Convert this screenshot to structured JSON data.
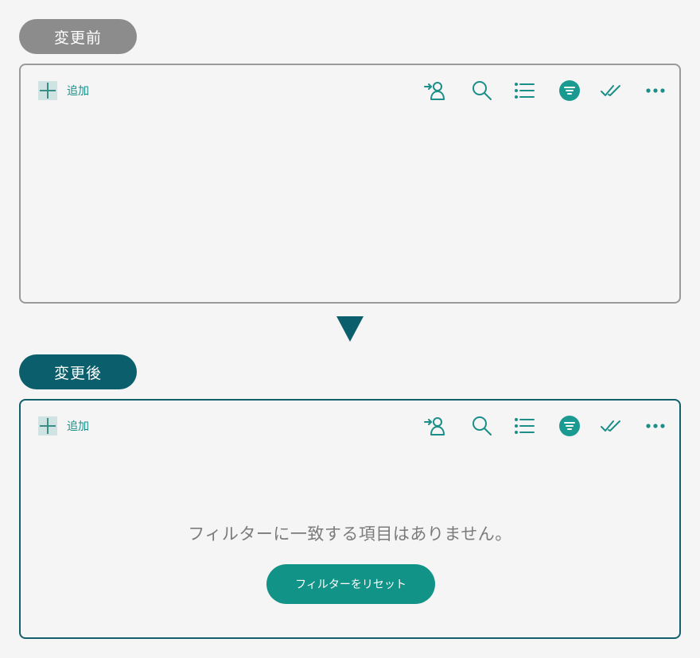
{
  "before": {
    "label": "変更前",
    "toolbar": {
      "add_label": "追加"
    }
  },
  "after": {
    "label": "変更後",
    "toolbar": {
      "add_label": "追加"
    },
    "empty_message": "フィルターに一致する項目はありません。",
    "reset_button_label": "フィルターをリセット"
  },
  "icons": [
    "plus-icon",
    "assign-person-icon",
    "search-icon",
    "list-icon",
    "filter-icon",
    "double-check-icon",
    "more-icon"
  ],
  "colors": {
    "accent": "#129388",
    "dark_teal": "#0b5e6b",
    "gray_pill": "#8c8c8c",
    "background": "#f5f5f5"
  }
}
